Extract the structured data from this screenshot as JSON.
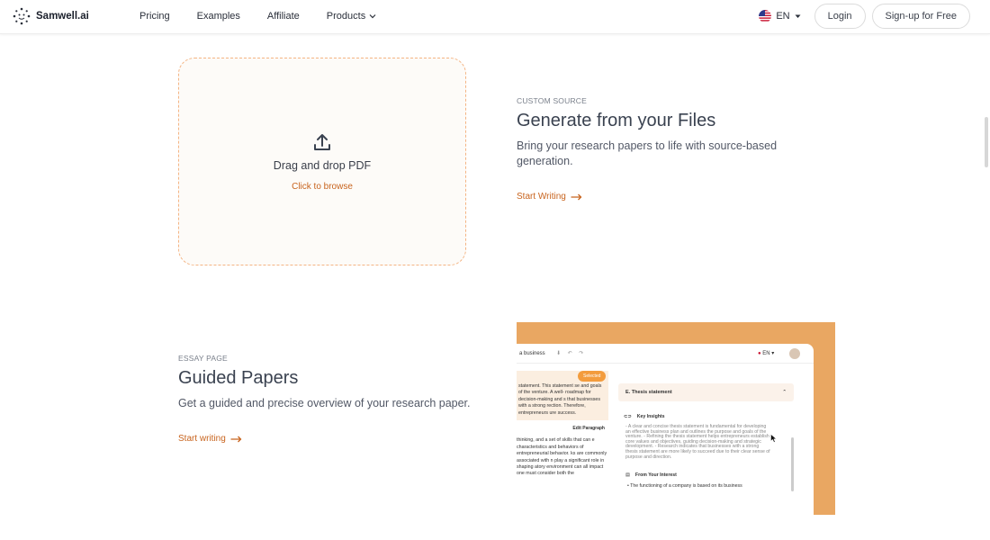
{
  "brand": {
    "name": "Samwell.ai"
  },
  "nav": {
    "items": [
      "Pricing",
      "Examples",
      "Affiliate",
      "Products"
    ]
  },
  "lang": {
    "code": "EN"
  },
  "header": {
    "login": "Login",
    "signup": "Sign-up for Free"
  },
  "dropzone": {
    "title": "Drag and drop PDF",
    "browse": "Click to browse"
  },
  "section1": {
    "eyebrow": "CUSTOM SOURCE",
    "heading": "Generate from your Files",
    "desc": "Bring your research papers to life with source-based generation.",
    "cta": "Start Writing"
  },
  "section2": {
    "eyebrow": "ESSAY PAGE",
    "heading": "Guided Papers",
    "desc": "Get a guided and precise overview of your research paper.",
    "cta": "Start writing"
  },
  "preview": {
    "title": "a business",
    "lang": "EN",
    "badge": "Selected",
    "left_para": "statement. This statement se and goals of the venture. A well- roadmap for decision-making and s that businesses with a strong rection. Therefore, entrepreneurs ure success.",
    "edit": "Edit Paragraph",
    "left_para2": "thinking, and a set of skills that can e characteristics and behaviors of entrepreneurial behavior. ks are commonly associated with n play a significant role in shaping atory environment can all impact one must consider both the",
    "accordion": "E. Thesis statement",
    "key_insights": "Key Insights",
    "insights_text": "- A clear and concise thesis statement is fundamental for developing an effective business plan and outlines the purpose and goals of the venture. - Refining the thesis statement helps entrepreneurs establish core values and objectives, guiding decision-making and strategic development. - Research indicates that businesses with a strong thesis statement are more likely to succeed due to their clear sense of purpose and direction.",
    "from_interest": "From Your Interest",
    "bullet": "The functioning of a company is based on its business"
  },
  "colors": {
    "accent": "#c8641e",
    "dashed_border": "#f4b483",
    "preview_bg": "#e9a762"
  }
}
